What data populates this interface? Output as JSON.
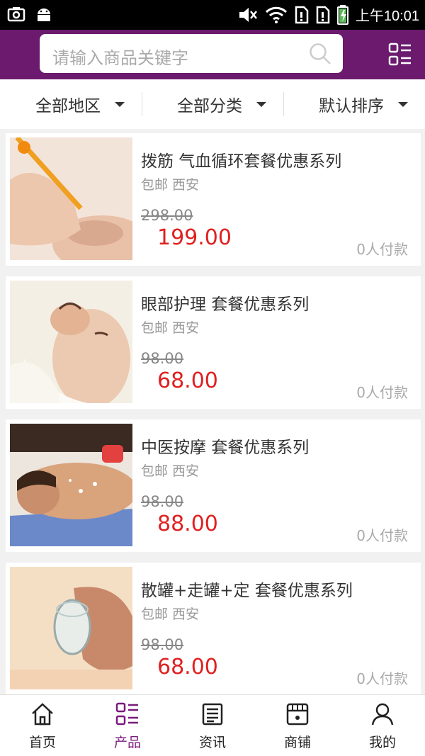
{
  "status_bar": {
    "time": "上午10:01"
  },
  "search": {
    "placeholder": "请输入商品关键字"
  },
  "filters": [
    {
      "label": "全部地区"
    },
    {
      "label": "全部分类"
    },
    {
      "label": "默认排序"
    }
  ],
  "products": [
    {
      "title": "拨筋 气血循环套餐优惠系列",
      "location": "包邮 西安",
      "old_price": "298.00",
      "price": "199.00",
      "paid": "0人付款"
    },
    {
      "title": "眼部护理 套餐优惠系列",
      "location": "包邮 西安",
      "old_price": "98.00",
      "price": "68.00",
      "paid": "0人付款"
    },
    {
      "title": "中医按摩 套餐优惠系列",
      "location": "包邮 西安",
      "old_price": "98.00",
      "price": "88.00",
      "paid": "0人付款"
    },
    {
      "title": "散罐+走罐+定 套餐优惠系列",
      "location": "包邮 西安",
      "old_price": "98.00",
      "price": "68.00",
      "paid": "0人付款"
    }
  ],
  "nav": [
    {
      "label": "首页",
      "icon": "home-icon"
    },
    {
      "label": "产品",
      "icon": "grid-list-icon",
      "active": true
    },
    {
      "label": "资讯",
      "icon": "news-icon"
    },
    {
      "label": "商铺",
      "icon": "store-icon"
    },
    {
      "label": "我的",
      "icon": "user-icon"
    }
  ],
  "colors": {
    "header": "#6b1a6e",
    "price": "#e02020",
    "active_nav": "#7a1a7e"
  }
}
